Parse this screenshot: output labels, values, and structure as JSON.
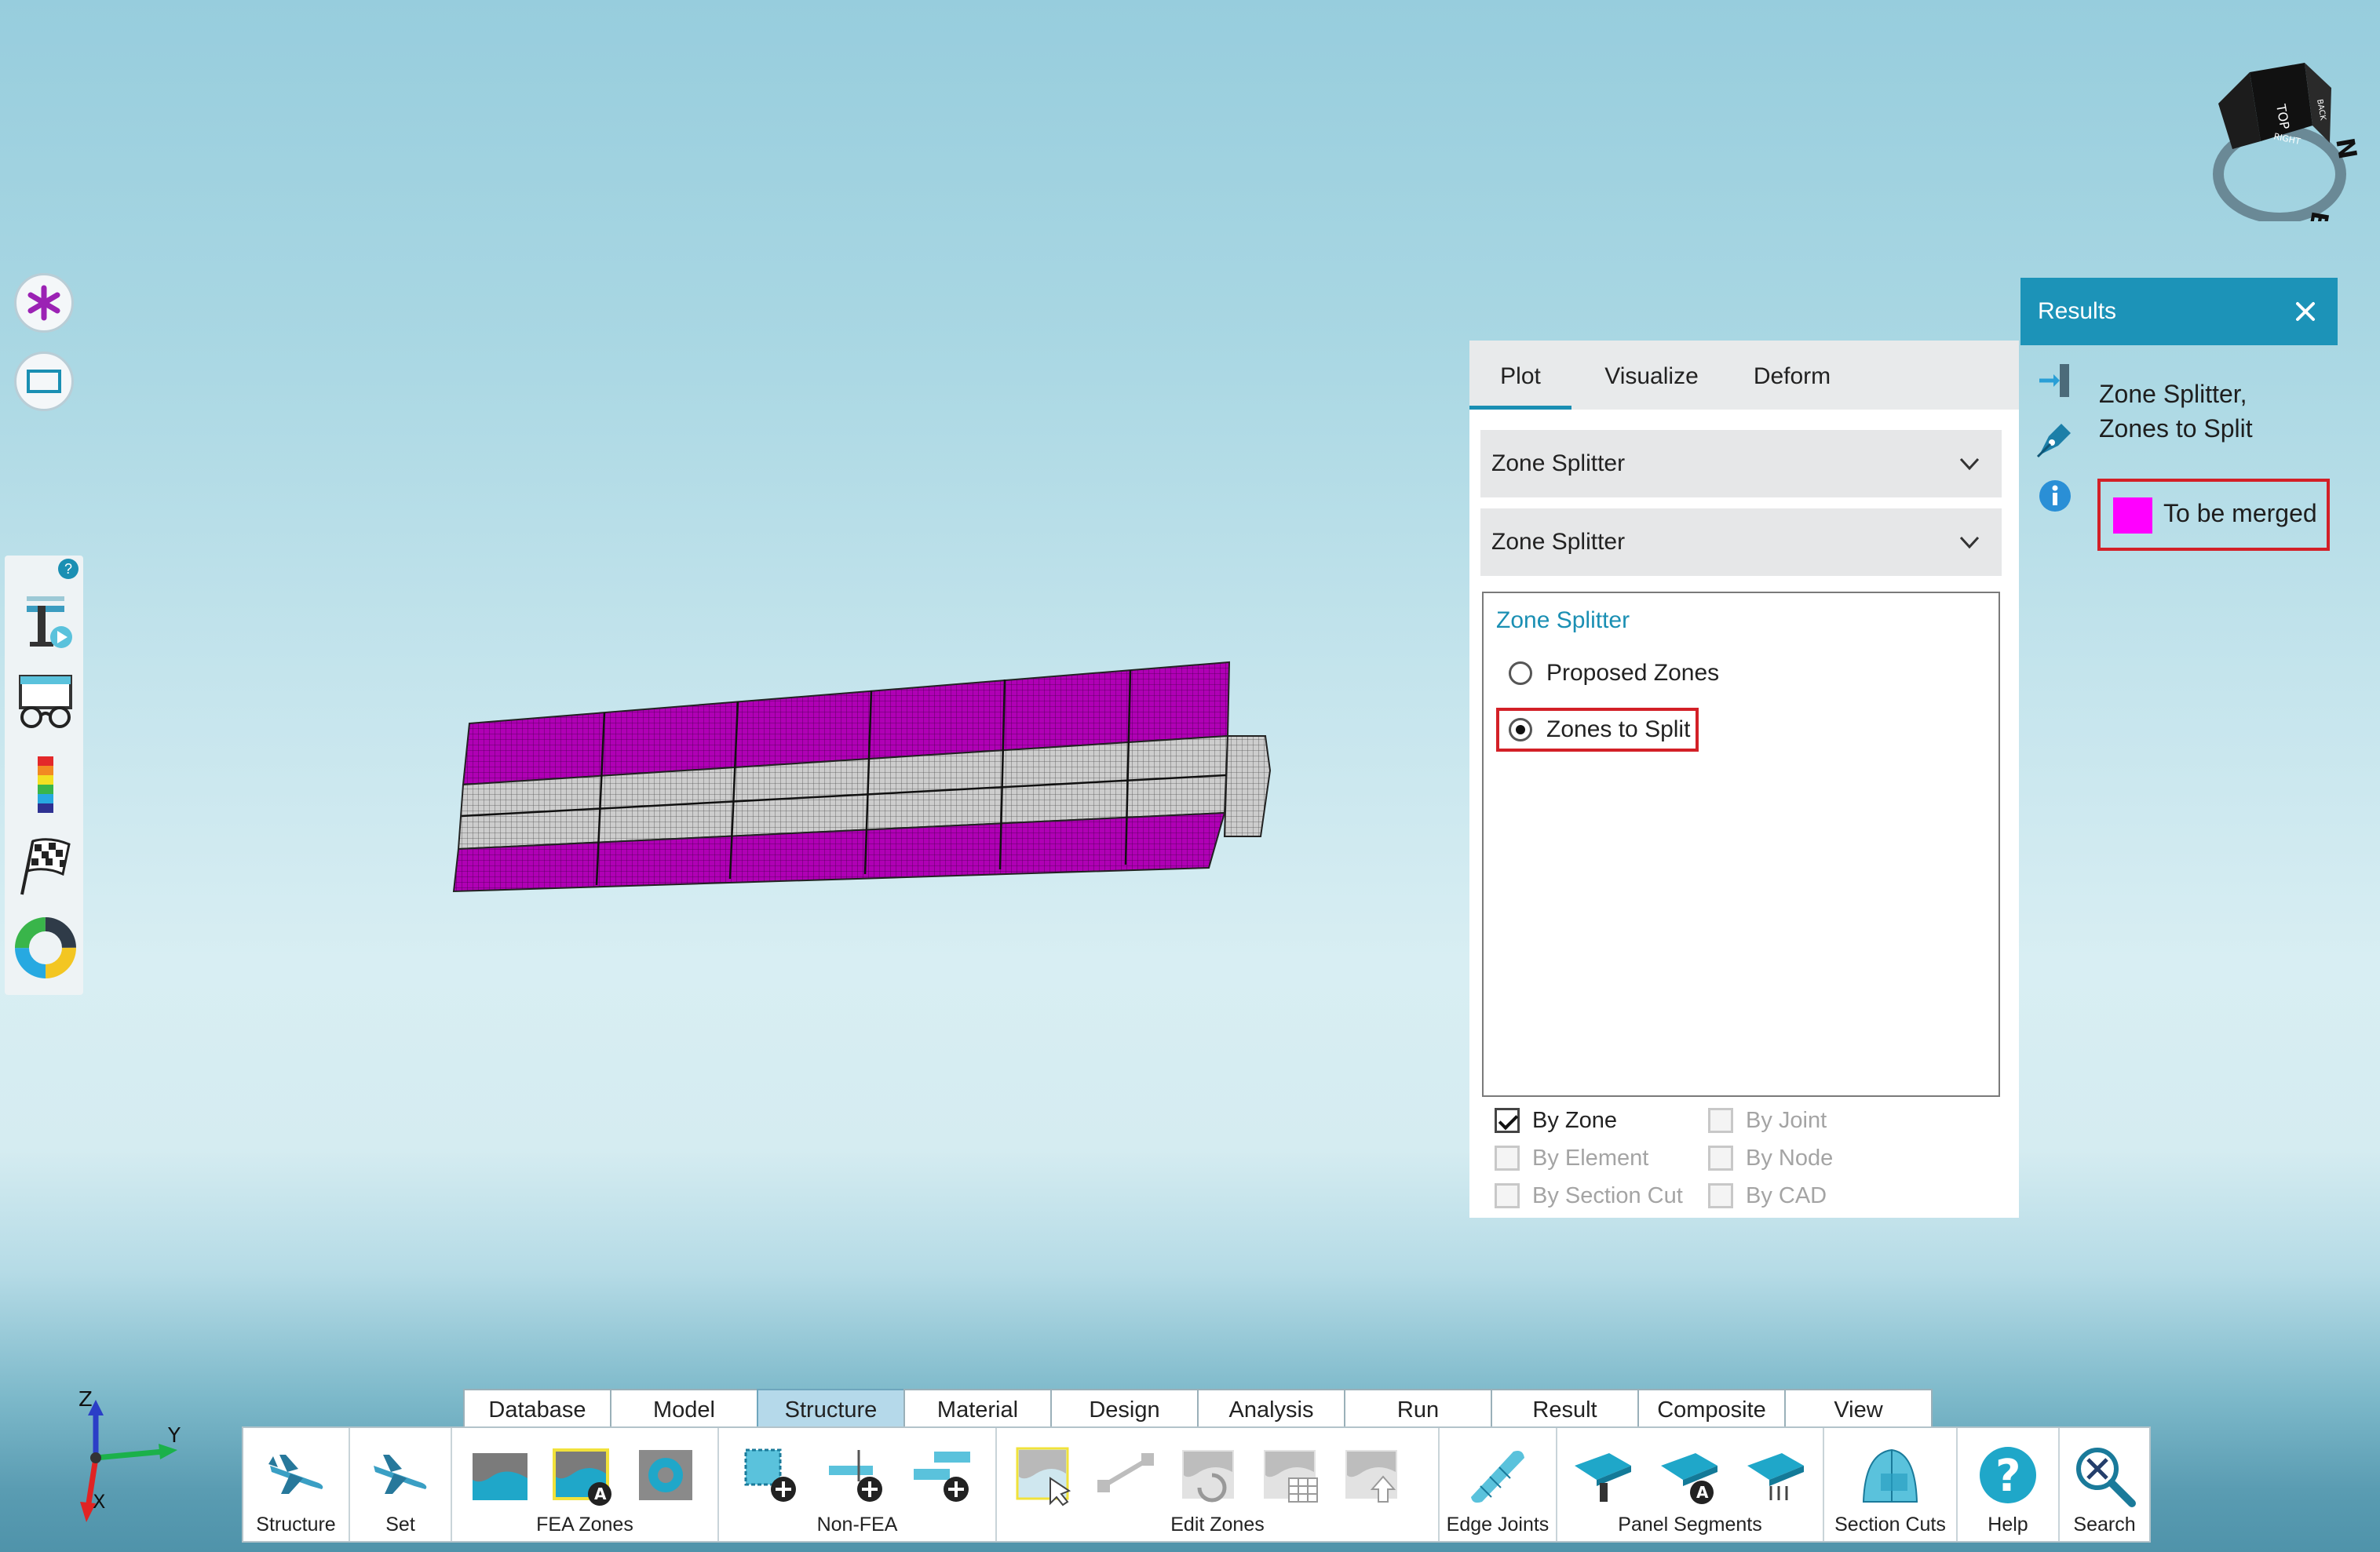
{
  "left_tools": {
    "top_buttons": [
      "asterisk-icon",
      "rectangle-icon"
    ],
    "strip_badge": "?",
    "strip_icons": [
      "text-tool-icon",
      "glasses-icon",
      "color-scale-icon",
      "checkered-flag-icon",
      "color-wheel-icon"
    ]
  },
  "navcube": {
    "top_label": "TOP",
    "right_label": "RIGHT",
    "back_label": "BACK",
    "north": "N",
    "east": "E"
  },
  "plot_panel": {
    "tabs": [
      {
        "label": "Plot",
        "active": true
      },
      {
        "label": "Visualize",
        "active": false
      },
      {
        "label": "Deform",
        "active": false
      }
    ],
    "dropdown1": "Zone Splitter",
    "dropdown2": "Zone Splitter",
    "group_title": "Zone Splitter",
    "radios": [
      {
        "label": "Proposed Zones",
        "selected": false
      },
      {
        "label": "Zones to Split",
        "selected": true
      }
    ],
    "checkboxes": [
      {
        "label": "By Zone",
        "checked": true,
        "enabled": true
      },
      {
        "label": "By Joint",
        "checked": false,
        "enabled": false
      },
      {
        "label": "By Element",
        "checked": false,
        "enabled": false
      },
      {
        "label": "By Node",
        "checked": false,
        "enabled": false
      },
      {
        "label": "By Section Cut",
        "checked": false,
        "enabled": false
      },
      {
        "label": "By CAD",
        "checked": false,
        "enabled": false
      }
    ]
  },
  "results": {
    "title": "Results",
    "line1": "Zone Splitter,",
    "line2": "Zones to Split",
    "legend_label": "To be merged",
    "legend_color": "#ff00ff"
  },
  "ribbon": {
    "tabs": [
      {
        "label": "Database",
        "active": false
      },
      {
        "label": "Model",
        "active": false
      },
      {
        "label": "Structure",
        "active": true
      },
      {
        "label": "Material",
        "active": false
      },
      {
        "label": "Design",
        "active": false
      },
      {
        "label": "Analysis",
        "active": false
      },
      {
        "label": "Run",
        "active": false
      },
      {
        "label": "Result",
        "active": false
      },
      {
        "label": "Composite",
        "active": false
      },
      {
        "label": "View",
        "active": false
      }
    ],
    "groups": {
      "structure": "Structure",
      "set": "Set",
      "fea_zones": "FEA Zones",
      "non_fea": "Non-FEA",
      "edit_zones": "Edit Zones",
      "edge_joints": "Edge Joints",
      "panel_segments": "Panel Segments",
      "section_cuts": "Section Cuts",
      "help": "Help",
      "search": "Search"
    },
    "badge_letter": "A"
  },
  "axes": {
    "z": "Z",
    "y": "Y",
    "x": "X"
  },
  "colors": {
    "accent": "#1a8fb3",
    "zone_magenta": "#b000b5",
    "zone_gray": "#c9c9c9",
    "highlight_red": "#d32027"
  }
}
